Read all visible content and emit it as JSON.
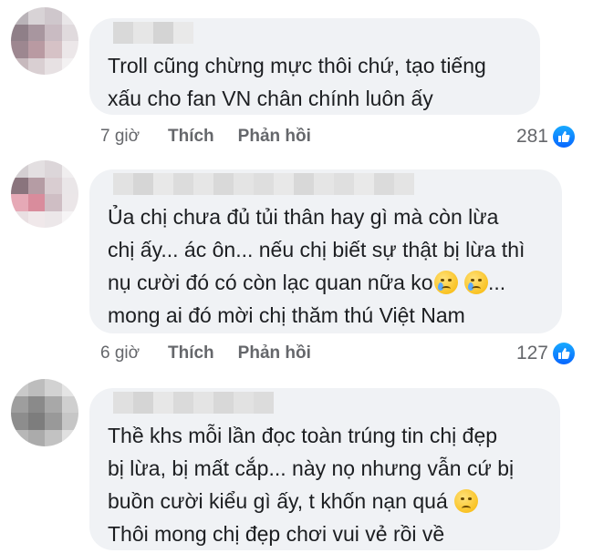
{
  "comments": [
    {
      "lines": [
        "Troll cũng chừng mực thôi chứ, tạo tiếng",
        "xấu cho fan VN chân chính luôn ấy"
      ],
      "time": "7 giờ",
      "like_label": "Thích",
      "reply_label": "Phản hồi",
      "reaction_count": "281",
      "reaction_icon": "like-icon"
    },
    {
      "lines": [
        "Ủa chị chưa đủ tủi thân hay gì mà còn lừa",
        "chị ấy... ác ôn... nếu chị biết sự thật bị lừa thì",
        "nụ cười đó có còn lạc quan nữa ko",
        "mong ai đó mời chị thăm thú Việt Nam"
      ],
      "line3_suffix": "...",
      "time": "6 giờ",
      "like_label": "Thích",
      "reply_label": "Phản hồi",
      "reaction_count": "127",
      "reaction_icon": "like-icon"
    },
    {
      "lines": [
        "Thề khs mỗi lần đọc toàn trúng tin chị đẹp",
        "bị lừa, bị mất cắp... này nọ nhưng vẫn cứ bị",
        "buồn cười kiểu gì ấy, t khốn nạn quá",
        "Thôi mong chị đẹp chơi vui vẻ rồi về"
      ]
    }
  ],
  "colors": {
    "bubble": "#f0f2f5",
    "meta_text": "#65676b",
    "like_blue": "#0866ff"
  }
}
